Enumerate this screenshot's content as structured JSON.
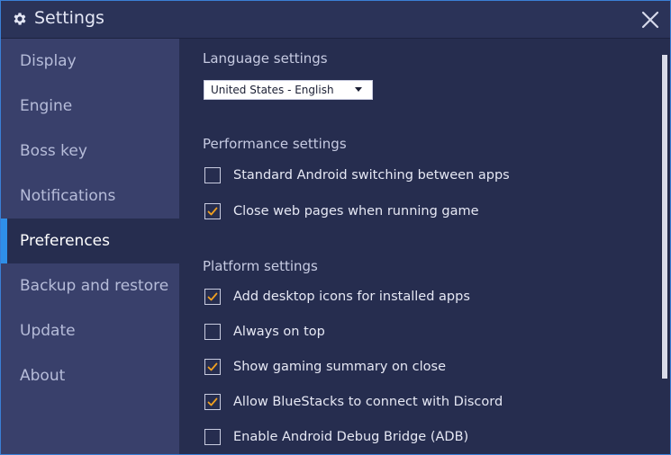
{
  "window": {
    "title": "Settings"
  },
  "sidebar": {
    "items": [
      {
        "label": "Display"
      },
      {
        "label": "Engine"
      },
      {
        "label": "Boss key"
      },
      {
        "label": "Notifications"
      },
      {
        "label": "Preferences"
      },
      {
        "label": "Backup and restore"
      },
      {
        "label": "Update"
      },
      {
        "label": "About"
      }
    ],
    "active": "Preferences"
  },
  "language": {
    "title": "Language settings",
    "selected": "United States - English"
  },
  "performance": {
    "title": "Performance settings",
    "options": [
      {
        "label": "Standard Android switching between apps",
        "checked": false
      },
      {
        "label": "Close web pages when running game",
        "checked": true
      }
    ]
  },
  "platform": {
    "title": "Platform settings",
    "options": [
      {
        "label": "Add desktop icons for installed apps",
        "checked": true
      },
      {
        "label": "Always on top",
        "checked": false
      },
      {
        "label": "Show gaming summary on close",
        "checked": true
      },
      {
        "label": "Allow BlueStacks to connect with Discord",
        "checked": true
      },
      {
        "label": "Enable Android Debug Bridge (ADB)",
        "checked": false
      }
    ]
  },
  "colors": {
    "accent": "#2f8fe8",
    "checkmark": "#f0a020",
    "sidebar": "#39406b",
    "content": "#262d4f"
  },
  "icons": {
    "title": "gear-icon",
    "close": "close-icon",
    "select": "chevron-down-icon",
    "check": "checkmark-icon"
  }
}
